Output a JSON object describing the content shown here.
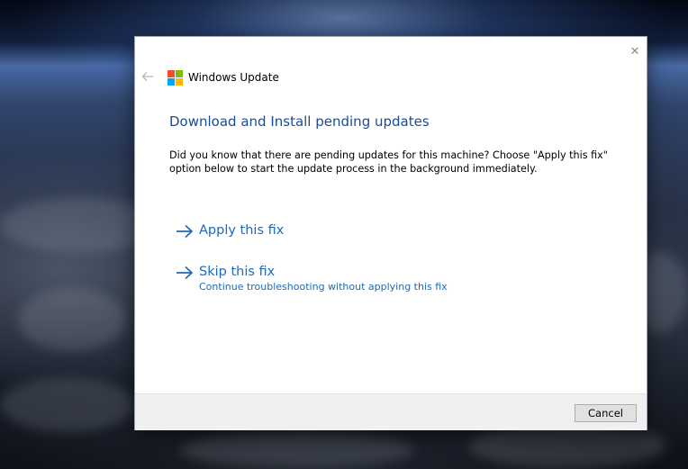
{
  "window": {
    "title": "Windows Update",
    "close_glyph": "✕"
  },
  "content": {
    "heading": "Download and Install pending updates",
    "description": "Did you know that there are pending updates for this machine? Choose \"Apply this fix\" option below to start the update process in the background immediately."
  },
  "options": [
    {
      "title": "Apply this fix",
      "subtitle": "",
      "icon": "arrow-right-icon"
    },
    {
      "title": "Skip this fix",
      "subtitle": "Continue troubleshooting without applying this fix",
      "icon": "arrow-right-icon"
    }
  ],
  "footer": {
    "cancel_label": "Cancel"
  },
  "colors": {
    "heading": "#1b4b95",
    "link": "#1c6ab8",
    "logo_red": "#f25022",
    "logo_green": "#7fba00",
    "logo_blue": "#00a4ef",
    "logo_yellow": "#ffb900"
  }
}
